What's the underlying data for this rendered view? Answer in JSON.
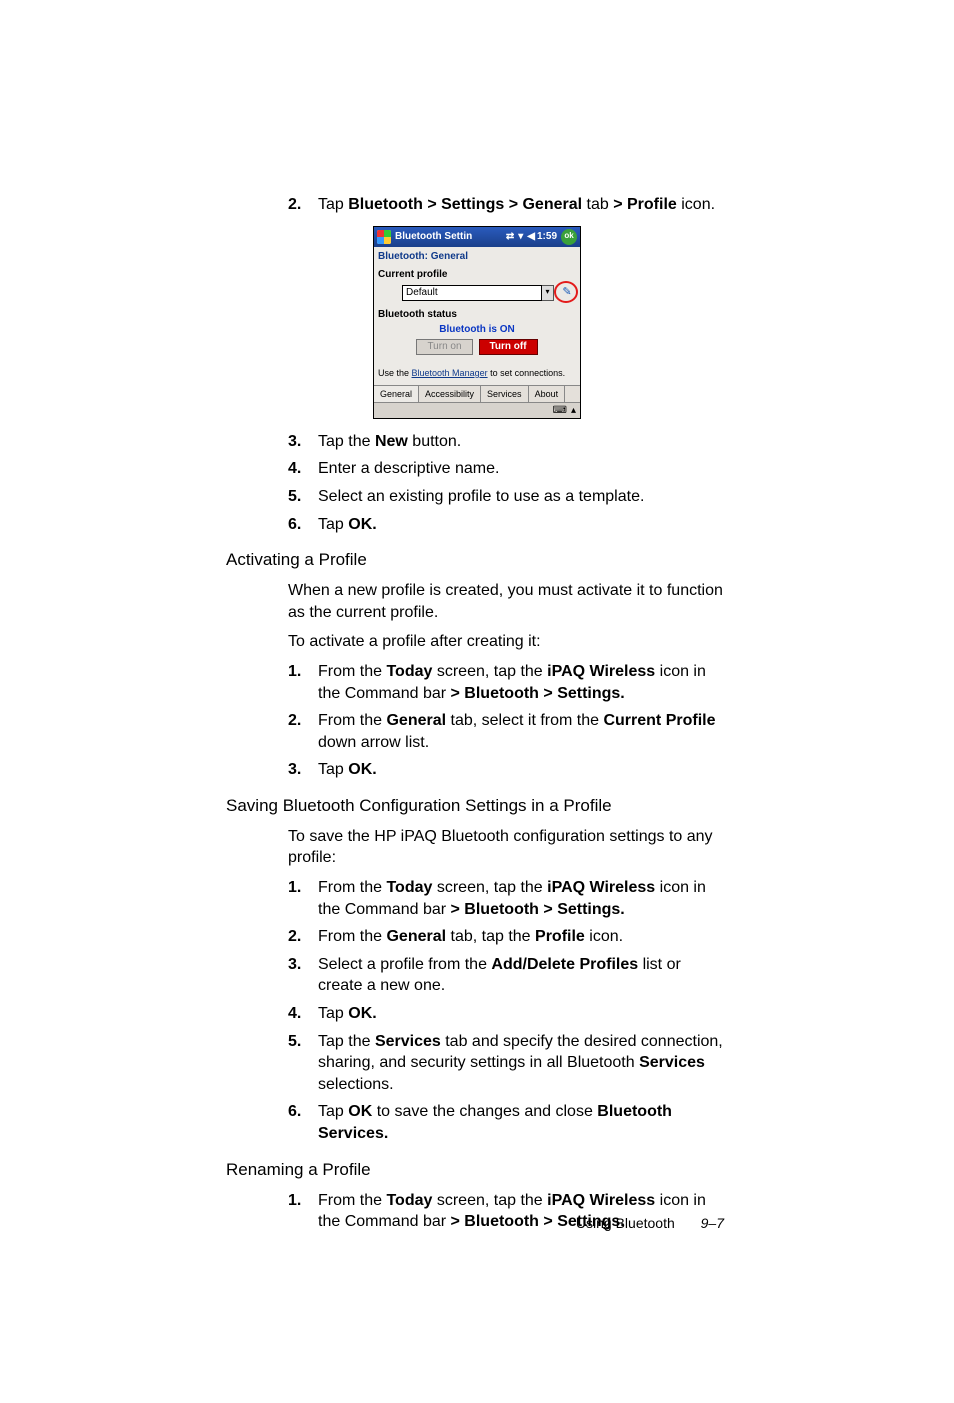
{
  "steps_a": [
    {
      "n": "2.",
      "segments": [
        {
          "t": "Tap "
        },
        {
          "t": "Bluetooth > Settings > General",
          "b": true
        },
        {
          "t": " tab "
        },
        {
          "t": "> Profile",
          "b": true
        },
        {
          "t": " icon."
        }
      ]
    }
  ],
  "screenshot": {
    "titlebar_title": "Bluetooth Settin",
    "titlebar_time": "1:59",
    "ok_label": "ok",
    "section_label": "Bluetooth: General",
    "current_profile_label": "Current profile",
    "profile_value": "Default",
    "status_label": "Bluetooth status",
    "status_value": "Bluetooth is ON",
    "turn_on": "Turn on",
    "turn_off": "Turn off",
    "use_mgr_pre": "Use the ",
    "use_mgr_link": "Bluetooth Manager",
    "use_mgr_post": " to set connections.",
    "tabs": [
      "General",
      "Accessibility",
      "Services",
      "About"
    ]
  },
  "steps_b": [
    {
      "n": "3.",
      "segments": [
        {
          "t": "Tap the "
        },
        {
          "t": "New",
          "b": true
        },
        {
          "t": " button."
        }
      ]
    },
    {
      "n": "4.",
      "segments": [
        {
          "t": "Enter a descriptive name."
        }
      ]
    },
    {
      "n": "5.",
      "segments": [
        {
          "t": "Select an existing profile to use as a template."
        }
      ]
    },
    {
      "n": "6.",
      "segments": [
        {
          "t": "Tap "
        },
        {
          "t": "OK.",
          "b": true
        }
      ]
    }
  ],
  "heading_activate": "Activating a Profile",
  "para_activate_1": "When a new profile is created, you must activate it to function as the current profile.",
  "para_activate_2": "To activate a profile after creating it:",
  "steps_activate": [
    {
      "n": "1.",
      "segments": [
        {
          "t": "From the "
        },
        {
          "t": "Today",
          "b": true
        },
        {
          "t": " screen, tap the "
        },
        {
          "t": "iPAQ Wireless",
          "b": true
        },
        {
          "t": " icon in the Command bar "
        },
        {
          "t": "> Bluetooth > Settings.",
          "b": true
        }
      ]
    },
    {
      "n": "2.",
      "segments": [
        {
          "t": "From the "
        },
        {
          "t": "General",
          "b": true
        },
        {
          "t": " tab, select it from the "
        },
        {
          "t": "Current Profile",
          "b": true
        },
        {
          "t": " down arrow list."
        }
      ]
    },
    {
      "n": "3.",
      "segments": [
        {
          "t": "Tap "
        },
        {
          "t": "OK.",
          "b": true
        }
      ]
    }
  ],
  "heading_save": "Saving Bluetooth Configuration Settings in a Profile",
  "para_save": "To save the HP iPAQ Bluetooth configuration settings to any profile:",
  "steps_save": [
    {
      "n": "1.",
      "segments": [
        {
          "t": "From the "
        },
        {
          "t": "Today",
          "b": true
        },
        {
          "t": " screen, tap the "
        },
        {
          "t": "iPAQ Wireless",
          "b": true
        },
        {
          "t": " icon in the Command bar "
        },
        {
          "t": "> Bluetooth > Settings.",
          "b": true
        }
      ]
    },
    {
      "n": "2.",
      "segments": [
        {
          "t": "From the "
        },
        {
          "t": "General",
          "b": true
        },
        {
          "t": " tab, tap the "
        },
        {
          "t": "Profile",
          "b": true
        },
        {
          "t": " icon."
        }
      ]
    },
    {
      "n": "3.",
      "segments": [
        {
          "t": "Select a profile from the "
        },
        {
          "t": "Add/Delete Profiles",
          "b": true
        },
        {
          "t": " list or create a new one."
        }
      ]
    },
    {
      "n": "4.",
      "segments": [
        {
          "t": "Tap "
        },
        {
          "t": "OK.",
          "b": true
        }
      ]
    },
    {
      "n": "5.",
      "segments": [
        {
          "t": "Tap the "
        },
        {
          "t": "Services",
          "b": true
        },
        {
          "t": " tab and specify the desired connection, sharing, and security settings in all Bluetooth "
        },
        {
          "t": "Services",
          "b": true
        },
        {
          "t": " selections."
        }
      ]
    },
    {
      "n": "6.",
      "segments": [
        {
          "t": "Tap "
        },
        {
          "t": "OK",
          "b": true
        },
        {
          "t": " to save the changes and close "
        },
        {
          "t": "Bluetooth Services.",
          "b": true
        }
      ]
    }
  ],
  "heading_rename": "Renaming a Profile",
  "steps_rename": [
    {
      "n": "1.",
      "segments": [
        {
          "t": "From the "
        },
        {
          "t": "Today",
          "b": true
        },
        {
          "t": " screen, tap the "
        },
        {
          "t": "iPAQ Wireless",
          "b": true
        },
        {
          "t": " icon in the Command bar "
        },
        {
          "t": "> Bluetooth > Settings.",
          "b": true
        }
      ]
    }
  ],
  "footer_section": "Using Bluetooth",
  "footer_page": "9–7"
}
